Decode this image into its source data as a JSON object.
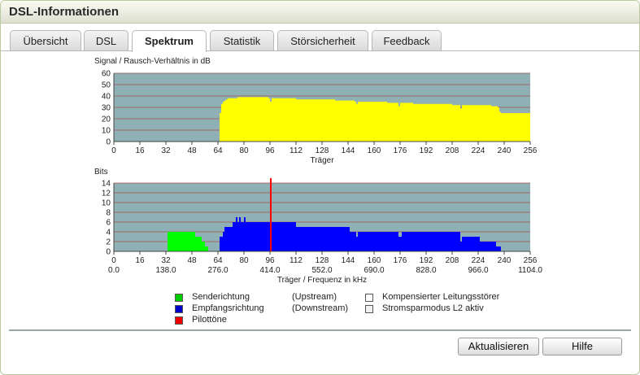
{
  "window": {
    "title": "DSL-Informationen"
  },
  "tabs": [
    {
      "label": "Übersicht",
      "active": false
    },
    {
      "label": "DSL",
      "active": false
    },
    {
      "label": "Spektrum",
      "active": true
    },
    {
      "label": "Statistik",
      "active": false
    },
    {
      "label": "Störsicherheit",
      "active": false
    },
    {
      "label": "Feedback",
      "active": false
    }
  ],
  "chart_data": [
    {
      "type": "bar",
      "title": "Signal / Rausch-Verhältnis in dB",
      "xlabel": "Träger",
      "ylabel": "",
      "xlim": [
        0,
        256
      ],
      "ylim": [
        0,
        60
      ],
      "xticks": [
        "0",
        "16",
        "32",
        "48",
        "64",
        "80",
        "96",
        "112",
        "128",
        "144",
        "160",
        "176",
        "192",
        "208",
        "224",
        "240",
        "256"
      ],
      "yticks": [
        "0",
        "10",
        "20",
        "30",
        "40",
        "50",
        "60"
      ],
      "colors": {
        "background": "#8fb0b4",
        "grid": "#a55050",
        "bars": "#ffff00"
      },
      "series": [
        {
          "values": [
            [
              65,
              25
            ],
            [
              66,
              33
            ],
            [
              67,
              35
            ],
            [
              68,
              36
            ],
            [
              69,
              37
            ],
            [
              70,
              38
            ],
            [
              72,
              38
            ],
            [
              76,
              39
            ],
            [
              80,
              39
            ],
            [
              88,
              39
            ],
            [
              95,
              38
            ],
            [
              96,
              37
            ],
            [
              97,
              38
            ],
            [
              104,
              38
            ],
            [
              112,
              37
            ],
            [
              120,
              37
            ],
            [
              128,
              37
            ],
            [
              136,
              36
            ],
            [
              144,
              36
            ],
            [
              148,
              35
            ],
            [
              149,
              35
            ],
            [
              150,
              35
            ],
            [
              160,
              35
            ],
            [
              168,
              34
            ],
            [
              174,
              34
            ],
            [
              175,
              33
            ],
            [
              176,
              34
            ],
            [
              184,
              33
            ],
            [
              192,
              33
            ],
            [
              200,
              33
            ],
            [
              208,
              32
            ],
            [
              213,
              31
            ],
            [
              214,
              32
            ],
            [
              224,
              32
            ],
            [
              232,
              31
            ],
            [
              236,
              30
            ],
            [
              237,
              26
            ],
            [
              238,
              25
            ]
          ]
        }
      ]
    },
    {
      "type": "bar",
      "title": "Bits",
      "xlabel": "Träger / Frequenz in kHz",
      "ylabel": "",
      "xlim": [
        0,
        256
      ],
      "ylim": [
        0,
        14
      ],
      "xticks": [
        "0",
        "16",
        "32",
        "48",
        "64",
        "80",
        "96",
        "112",
        "128",
        "144",
        "160",
        "176",
        "192",
        "208",
        "224",
        "240",
        "256"
      ],
      "xticks_khz": [
        "0.0",
        "138.0",
        "276.0",
        "414.0",
        "552.0",
        "690.0",
        "828.0",
        "966.0",
        "1104.0"
      ],
      "yticks": [
        "0",
        "2",
        "4",
        "6",
        "8",
        "10",
        "12",
        "14"
      ],
      "colors": {
        "background": "#8fb0b4",
        "grid": "#a55050",
        "upstream": "#00ff00",
        "downstream": "#0000ff",
        "pilot": "#ff0000"
      },
      "series": [
        {
          "name": "Senderichtung",
          "values": [
            [
              33,
              4
            ],
            [
              40,
              4
            ],
            [
              50,
              3
            ],
            [
              54,
              2
            ],
            [
              56,
              1
            ],
            [
              58,
              0
            ]
          ]
        },
        {
          "name": "Empfangsrichtung",
          "values": [
            [
              65,
              3
            ],
            [
              67,
              4
            ],
            [
              68,
              5
            ],
            [
              73,
              6
            ],
            [
              75,
              7
            ],
            [
              76,
              6
            ],
            [
              77,
              7
            ],
            [
              78,
              6
            ],
            [
              80,
              7
            ],
            [
              81,
              6
            ],
            [
              82,
              6
            ],
            [
              96,
              6
            ],
            [
              112,
              5
            ],
            [
              128,
              5
            ],
            [
              145,
              4
            ],
            [
              160,
              4
            ],
            [
              175,
              4
            ],
            [
              176,
              3
            ],
            [
              177,
              4
            ],
            [
              200,
              4
            ],
            [
              213,
              3
            ],
            [
              225,
              2
            ],
            [
              235,
              1
            ],
            [
              238,
              0
            ]
          ]
        },
        {
          "name": "Pilottöne",
          "values": [
            [
              96,
              14
            ]
          ]
        }
      ]
    }
  ],
  "legend": [
    {
      "label": "Senderichtung",
      "dir": "(Upstream)",
      "color": "#00cc00"
    },
    {
      "label": "Empfangsrichtung",
      "dir": "(Downstream)",
      "color": "#0000cc"
    },
    {
      "label": "Pilottöne",
      "dir": "",
      "color": "#ee0000"
    }
  ],
  "legend_right": [
    {
      "label": "Kompensierter Leitungsstörer",
      "color": "#ffffff"
    },
    {
      "label": "Stromsparmodus L2 aktiv",
      "color": "#f0f0f0"
    }
  ],
  "buttons": {
    "refresh": "Aktualisieren",
    "help": "Hilfe"
  }
}
